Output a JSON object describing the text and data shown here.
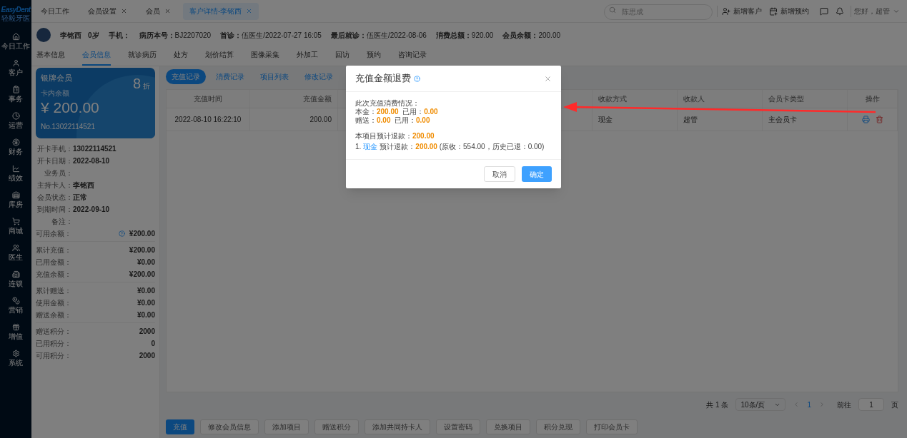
{
  "logo": {
    "name": "EasyDent",
    "subtitle": "轻毅牙医"
  },
  "sidebar": {
    "items": [
      {
        "label": "今日工作"
      },
      {
        "label": "客户"
      },
      {
        "label": "事务"
      },
      {
        "label": "运营"
      },
      {
        "label": "财务"
      },
      {
        "label": "绩效"
      },
      {
        "label": "库房"
      },
      {
        "label": "商城"
      },
      {
        "label": "医生"
      },
      {
        "label": "连锁"
      },
      {
        "label": "营销"
      },
      {
        "label": "增值"
      },
      {
        "label": "系统"
      }
    ]
  },
  "tabs": [
    {
      "label": "今日工作",
      "closable": false,
      "selected": false
    },
    {
      "label": "会员设置",
      "closable": true,
      "selected": false
    },
    {
      "label": "会员",
      "closable": true,
      "selected": false
    },
    {
      "label": "客户详情-李铭西",
      "closable": true,
      "selected": true
    }
  ],
  "topbar": {
    "search": {
      "placeholder": "陈思成"
    },
    "actions": [
      "新增客户",
      "新增预约"
    ],
    "greeting": "您好，超管"
  },
  "patient": {
    "name": "李铭西",
    "age": "0岁",
    "fields": [
      {
        "label": "手机："
      },
      {
        "label": "病历本号：",
        "value": "BJ2207020"
      },
      {
        "label": "首诊：",
        "value": "伍医生/2022-07-27 16:05"
      },
      {
        "label": "最后就诊：",
        "value": "伍医生/2022-08-06"
      },
      {
        "label": "消费总额：",
        "value": "920.00"
      },
      {
        "label": "会员余额：",
        "value": "200.00"
      }
    ]
  },
  "subtabs": [
    {
      "label": "基本信息",
      "selected": false
    },
    {
      "label": "会员信息",
      "selected": true
    },
    {
      "label": "就诊病历",
      "selected": false
    },
    {
      "label": "处方",
      "selected": false
    },
    {
      "label": "划价结算",
      "selected": false
    },
    {
      "label": "图像采集",
      "selected": false
    },
    {
      "label": "外加工",
      "selected": false
    },
    {
      "label": "回访",
      "selected": false
    },
    {
      "label": "预约",
      "selected": false
    },
    {
      "label": "咨询记录",
      "selected": false
    }
  ],
  "card": {
    "level": "银牌会员",
    "discount": "8",
    "discount_unit": "折",
    "balance_label": "卡内余额",
    "balance": "¥ 200.00",
    "number": "No.13022114521"
  },
  "info_groups": [
    [
      {
        "kind": "field",
        "label": "开卡手机：",
        "value": "13022114521",
        "help": false
      },
      {
        "kind": "field",
        "label": "开卡日期：",
        "value": "2022-08-10",
        "help": false
      },
      {
        "kind": "field",
        "label": "业务员：",
        "help": false
      },
      {
        "kind": "field",
        "label": "主持卡人：",
        "value": "李铭西",
        "help": false
      },
      {
        "kind": "field",
        "label": "会员状态：",
        "value": "正常",
        "help": false
      },
      {
        "kind": "field",
        "label": "到期时间：",
        "value": "2022-09-10",
        "help": false
      },
      {
        "kind": "field",
        "label": "备注：",
        "help": false
      },
      {
        "kind": "amount",
        "label": "可用余额：",
        "value": "¥200.00",
        "help": true
      }
    ],
    [
      {
        "kind": "amount",
        "label": "累计充值：",
        "value": "¥200.00",
        "help": false
      },
      {
        "kind": "amount",
        "label": "已用金额：",
        "value": "¥0.00",
        "help": false
      },
      {
        "kind": "amount",
        "label": "充值余额：",
        "value": "¥200.00",
        "help": false
      }
    ],
    [
      {
        "kind": "amount",
        "label": "累计赠送：",
        "value": "¥0.00",
        "help": false
      },
      {
        "kind": "amount",
        "label": "使用金额：",
        "value": "¥0.00",
        "help": false
      },
      {
        "kind": "amount",
        "label": "赠送余额：",
        "value": "¥0.00",
        "help": false
      }
    ],
    [
      {
        "kind": "amount",
        "label": "赠送积分：",
        "value": "2000",
        "help": false
      },
      {
        "kind": "amount",
        "label": "已用积分：",
        "value": "0",
        "help": false
      },
      {
        "kind": "amount",
        "label": "可用积分：",
        "value": "2000",
        "help": false
      }
    ]
  ],
  "record_tabs": [
    {
      "label": "充值记录",
      "selected": true
    },
    {
      "label": "消费记录",
      "selected": false
    },
    {
      "label": "项目列表",
      "selected": false
    },
    {
      "label": "修改记录",
      "selected": false
    }
  ],
  "table": {
    "columns": [
      "充值时间",
      "充值金额",
      null,
      "收款方式",
      "收款人",
      "会员卡类型",
      "操作"
    ],
    "rows": [
      [
        "2022-08-10 16:22:10",
        "200.00",
        null,
        "现金",
        "超管",
        "主会员卡"
      ]
    ]
  },
  "pagination": {
    "total": "共 1 条",
    "page_size": "10条/页",
    "current": "1",
    "goto_label": "前往",
    "goto_value": "1",
    "goto_unit": "页"
  },
  "actions": [
    {
      "label": "充值",
      "primary": true
    },
    {
      "label": "修改会员信息",
      "primary": false
    },
    {
      "label": "添加项目",
      "primary": false
    },
    {
      "label": "赠送积分",
      "primary": false
    },
    {
      "label": "添加共同持卡人",
      "primary": false
    },
    {
      "label": "设置密码",
      "primary": false
    },
    {
      "label": "兑换项目",
      "primary": false
    },
    {
      "label": "积分兑现",
      "primary": false
    },
    {
      "label": "打印会员卡",
      "primary": false
    }
  ],
  "dialog": {
    "title": "充值金额退费",
    "summary_title": "此次充值消费情况：",
    "summary_lines": [
      "本金：**200.00**  已用：**0.00**",
      "赠送：**0.00**  已用：**0.00**"
    ],
    "estimate": "本项目预计退款：**200.00**",
    "refunds": [
      {
        "index": "1.",
        "method": "现金",
        "detail": "预计退款：**200.00** (原收：554.00，历史已退：0.00)"
      }
    ],
    "buttons": [
      {
        "label": "取消",
        "primary": false
      },
      {
        "label": "确定",
        "primary": true
      }
    ]
  }
}
